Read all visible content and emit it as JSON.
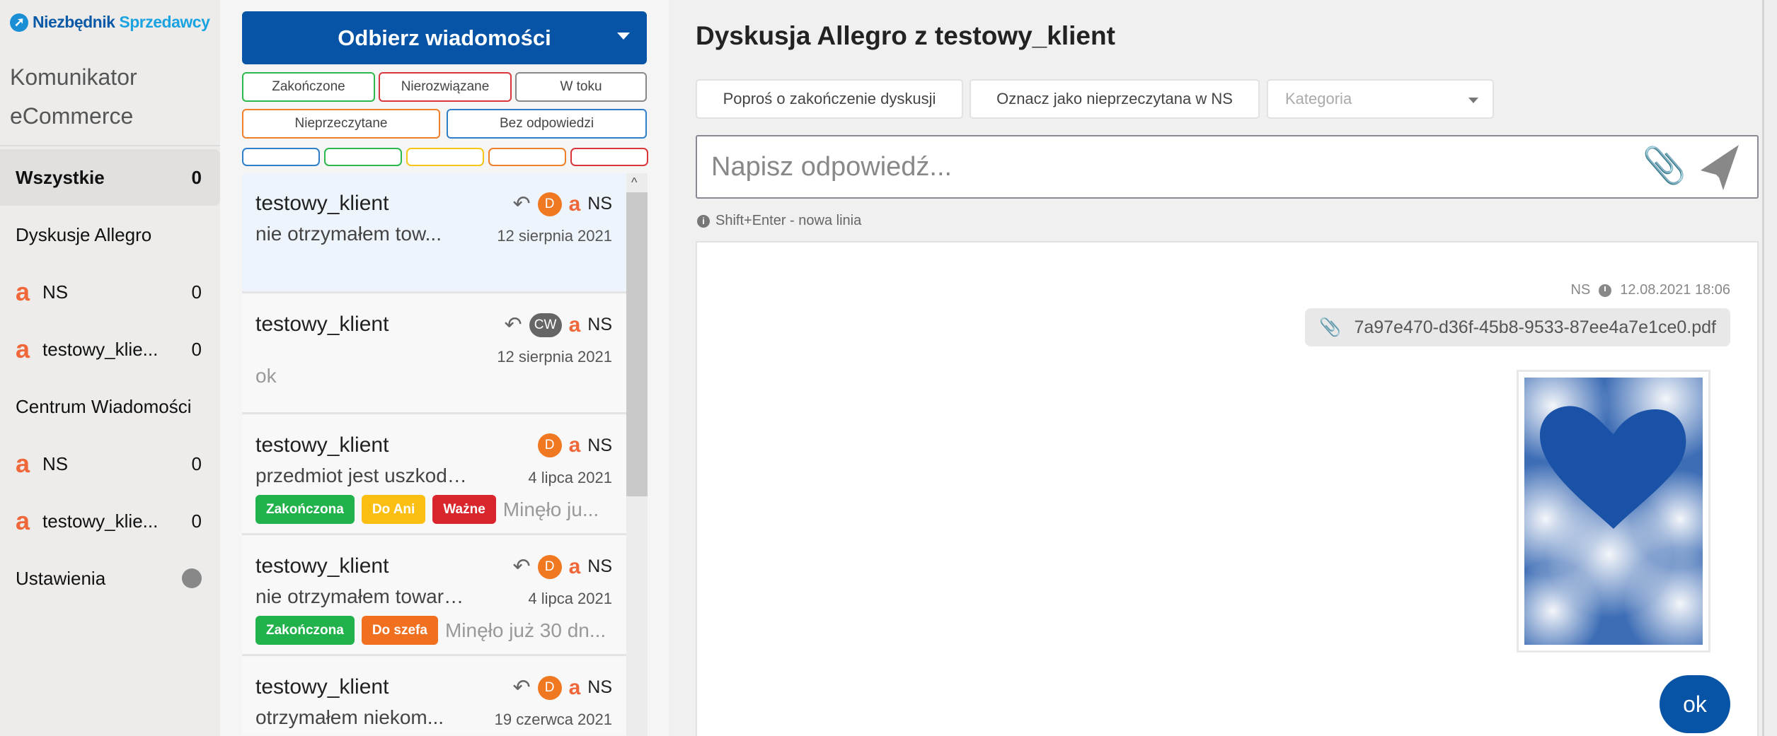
{
  "logo": {
    "part1": "Niezbędnik",
    "part2": "Sprzedawcy"
  },
  "app_title": [
    "Komunikator",
    "eCommerce"
  ],
  "sidebar": [
    {
      "label": "Wszystkie",
      "count": "0",
      "type": "active"
    },
    {
      "label": "Dyskusje Allegro",
      "type": "header"
    },
    {
      "label": "NS",
      "count": "0",
      "type": "allegro"
    },
    {
      "label": "testowy_klie...",
      "count": "0",
      "type": "allegro"
    },
    {
      "label": "Centrum Wiadomości",
      "type": "header"
    },
    {
      "label": "NS",
      "count": "0",
      "type": "allegro"
    },
    {
      "label": "testowy_klie...",
      "count": "0",
      "type": "allegro"
    },
    {
      "label": "Ustawienia",
      "type": "settings"
    }
  ],
  "allegro_mark": "a",
  "fetch_button": "Odbierz wiadomości",
  "filters": [
    {
      "label": "Zakończone",
      "color": "#2db84d"
    },
    {
      "label": "Nierozwiązane",
      "color": "#d9373c"
    },
    {
      "label": "W toku",
      "color": "#888888"
    },
    {
      "label": "Nieprzeczytane",
      "color": "#f07f2a"
    },
    {
      "label": "Bez odpowiedzi",
      "color": "#2f7fc8"
    }
  ],
  "color_filters": [
    "#2f7fc8",
    "#2db84d",
    "#f5c518",
    "#f07f2a",
    "#d9373c"
  ],
  "threads": [
    {
      "name": "testowy_klient",
      "reply": true,
      "badge": "D",
      "mark": "a",
      "account": "NS",
      "snippet": "nie otrzymałem tow...",
      "date": "12 sierpnia 2021",
      "selected": true,
      "tags": []
    },
    {
      "name": "testowy_klient",
      "reply": true,
      "badge": "CW",
      "mark": "a",
      "account": "NS",
      "snippet": "",
      "date": "12 sierpnia 2021",
      "extra": "ok",
      "tags": []
    },
    {
      "name": "testowy_klient",
      "reply": false,
      "badge": "D",
      "mark": "a",
      "account": "NS",
      "snippet": "przedmiot jest uszkodzo...",
      "date": "4 lipca 2021",
      "tags": [
        {
          "label": "Zakończona",
          "color": "#22b24c"
        },
        {
          "label": "Do Ani",
          "color": "#fbbf14"
        },
        {
          "label": "Ważne",
          "color": "#d8262c"
        }
      ],
      "more": "Minęło ju..."
    },
    {
      "name": "testowy_klient",
      "reply": true,
      "badge": "D",
      "mark": "a",
      "account": "NS",
      "snippet": "nie otrzymałem towaru ...",
      "date": "4 lipca 2021",
      "tags": [
        {
          "label": "Zakończona",
          "color": "#22b24c"
        },
        {
          "label": "Do szefa",
          "color": "#f07020"
        }
      ],
      "more": "Minęło już 30 dn..."
    },
    {
      "name": "testowy_klient",
      "reply": true,
      "badge": "D",
      "mark": "a",
      "account": "NS",
      "snippet": "otrzymałem niekom...",
      "date": "19 czerwca 2021",
      "tags": []
    }
  ],
  "conversation": {
    "title": "Dyskusja Allegro z testowy_klient",
    "actions": [
      "Poproś o zakończenie dyskusji",
      "Oznacz jako nieprzeczytana w NS"
    ],
    "category_placeholder": "Kategoria",
    "reply_placeholder": "Napisz odpowiedź...",
    "hint": "Shift+Enter - nowa linia",
    "message": {
      "author": "NS",
      "time": "12.08.2021 18:06",
      "attachment": "7a97e470-d36f-45b8-9533-87ee4a7e1ce0.pdf",
      "text": "ok"
    }
  }
}
